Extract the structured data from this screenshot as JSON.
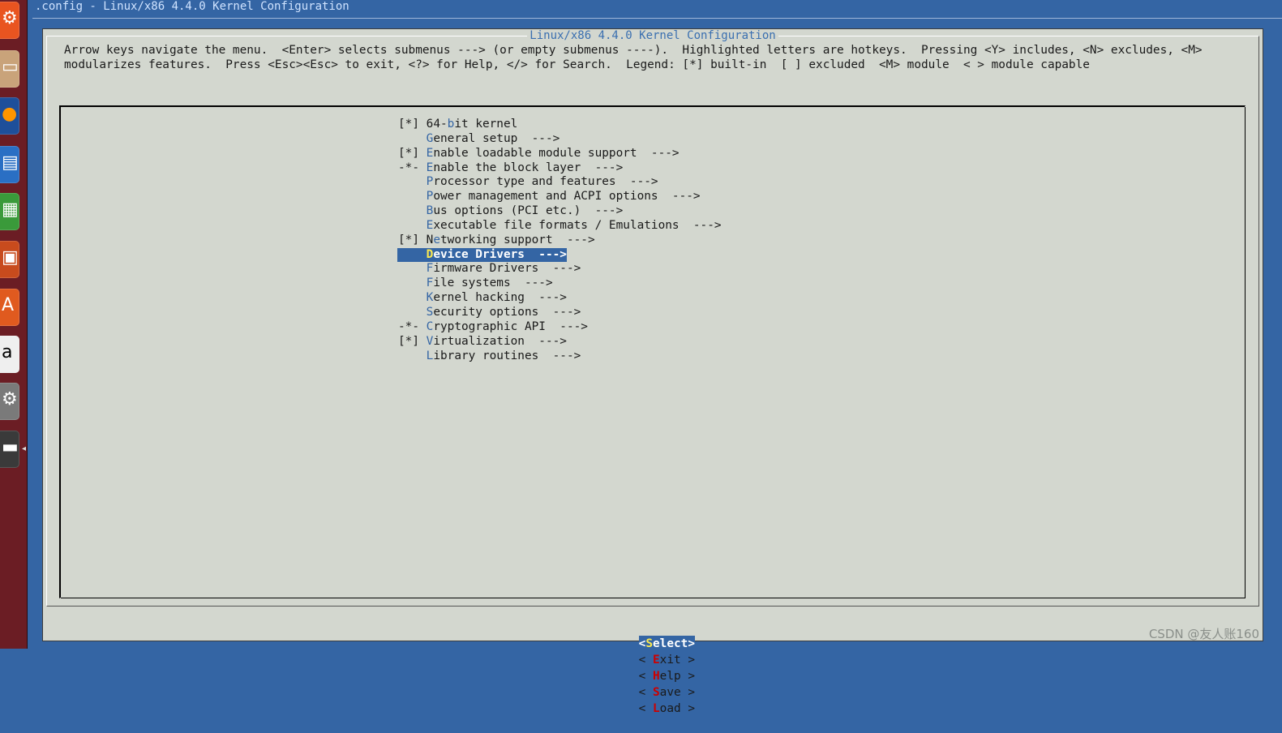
{
  "window": {
    "title": ".config - Linux/x86 4.4.0 Kernel Configuration"
  },
  "dialog": {
    "title": "Linux/x86 4.4.0 Kernel Configuration",
    "help_line1": "Arrow keys navigate the menu.  <Enter> selects submenus ---> (or empty submenus ----).  Highlighted letters are hotkeys.  Pressing <Y> includes, <N> excludes, <M>",
    "help_line2": "modularizes features.  Press <Esc><Esc> to exit, <?> for Help, </> for Search.  Legend: [*] built-in  [ ] excluded  <M> module  < > module capable"
  },
  "menu": {
    "items": [
      {
        "prefix": "[*] ",
        "before": "64-",
        "hotkey": "b",
        "after": "it kernel",
        "selected": false
      },
      {
        "prefix": "    ",
        "before": "",
        "hotkey": "G",
        "after": "eneral setup  --->",
        "selected": false
      },
      {
        "prefix": "[*] ",
        "before": "",
        "hotkey": "E",
        "after": "nable loadable module support  --->",
        "selected": false
      },
      {
        "prefix": "-*- ",
        "before": "",
        "hotkey": "E",
        "after": "nable the block layer  --->",
        "selected": false
      },
      {
        "prefix": "    ",
        "before": "",
        "hotkey": "P",
        "after": "rocessor type and features  --->",
        "selected": false
      },
      {
        "prefix": "    ",
        "before": "",
        "hotkey": "P",
        "after": "ower management and ACPI options  --->",
        "selected": false
      },
      {
        "prefix": "    ",
        "before": "",
        "hotkey": "B",
        "after": "us options (PCI etc.)  --->",
        "selected": false
      },
      {
        "prefix": "    ",
        "before": "",
        "hotkey": "E",
        "after": "xecutable file formats / Emulations  --->",
        "selected": false
      },
      {
        "prefix": "[*] ",
        "before": "N",
        "hotkey": "e",
        "after": "tworking support  --->",
        "selected": false
      },
      {
        "prefix": "    ",
        "before": "",
        "hotkey": "D",
        "after": "evice Drivers  --->",
        "selected": true
      },
      {
        "prefix": "    ",
        "before": "",
        "hotkey": "F",
        "after": "irmware Drivers  --->",
        "selected": false
      },
      {
        "prefix": "    ",
        "before": "",
        "hotkey": "F",
        "after": "ile systems  --->",
        "selected": false
      },
      {
        "prefix": "    ",
        "before": "",
        "hotkey": "K",
        "after": "ernel hacking  --->",
        "selected": false
      },
      {
        "prefix": "    ",
        "before": "",
        "hotkey": "S",
        "after": "ecurity options  --->",
        "selected": false
      },
      {
        "prefix": "-*- ",
        "before": "",
        "hotkey": "C",
        "after": "ryptographic API  --->",
        "selected": false
      },
      {
        "prefix": "[*] ",
        "before": "",
        "hotkey": "V",
        "after": "irtualization  --->",
        "selected": false
      },
      {
        "prefix": "    ",
        "before": "",
        "hotkey": "L",
        "after": "ibrary routines  --->",
        "selected": false
      }
    ]
  },
  "buttons": {
    "select": {
      "open": "<",
      "hotkey": "S",
      "rest": "elect",
      "close": ">"
    },
    "exit": {
      "open": "< ",
      "hotkey": "E",
      "rest": "xit",
      "close": " >"
    },
    "help": {
      "open": "< ",
      "hotkey": "H",
      "rest": "elp",
      "close": " >"
    },
    "save": {
      "open": "< ",
      "hotkey": "S",
      "rest": "ave",
      "close": " >"
    },
    "load": {
      "open": "< ",
      "hotkey": "L",
      "rest": "oad",
      "close": " >"
    }
  },
  "watermark": "CSDN @友人账160",
  "launcher": {
    "icons": [
      "ubuntu-dash-icon",
      "files-icon",
      "firefox-icon",
      "writer-icon",
      "calc-icon",
      "impress-icon",
      "software-center-icon",
      "amazon-icon",
      "system-settings-icon",
      "terminal-icon"
    ]
  },
  "colors": {
    "desktop_blue": "#3465a4",
    "dialog_gray": "#d3d7cf",
    "hotkey_blue": "#3465a4",
    "selected_hotkey_yellow": "#fce94f",
    "button_hotkey_red": "#cc0000"
  }
}
